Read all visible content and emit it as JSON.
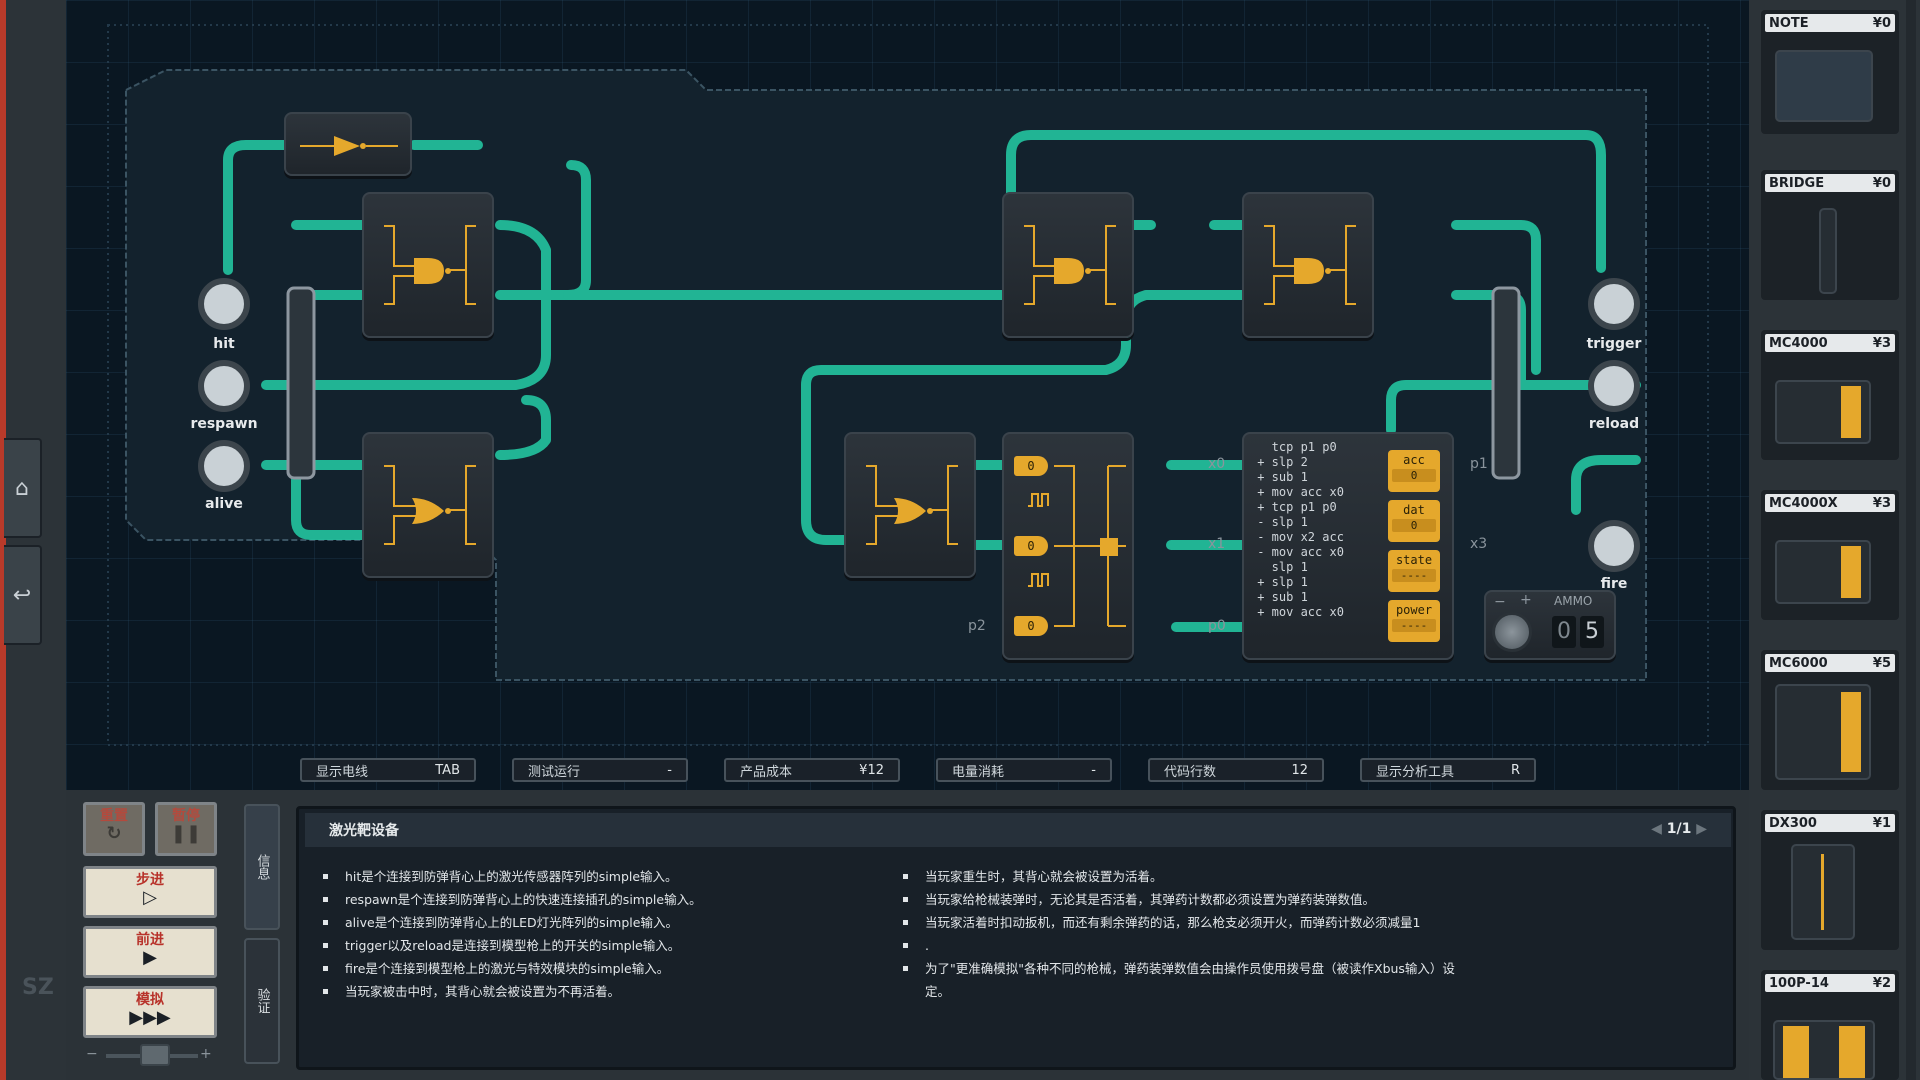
{
  "board": {
    "pins": {
      "hit": "hit",
      "respawn": "respawn",
      "alive": "alive",
      "trigger": "trigger",
      "reload": "reload",
      "fire": "fire"
    },
    "pin_labels": {
      "x0": "x0",
      "x1": "x1",
      "p2": "p2",
      "p0": "p0",
      "p1": "p1",
      "x3": "x3"
    },
    "mc_code": "   tcp p1 p0\n + slp 2\n + sub 1\n + mov acc x0\n + tcp p1 p0\n - slp 1\n - mov x2 acc\n - mov acc x0\n   slp 1\n + slp 1\n + sub 1\n + mov acc x0",
    "registers": [
      {
        "name": "acc",
        "value": "0"
      },
      {
        "name": "dat",
        "value": "0"
      },
      {
        "name": "state",
        "value": "----"
      },
      {
        "name": "power",
        "value": "----"
      }
    ],
    "dx_values": [
      "0",
      "0",
      "0"
    ],
    "ammo": {
      "title": "AMMO",
      "minus": "−",
      "plus": "+",
      "digits": [
        "0",
        "5"
      ]
    }
  },
  "statusbar": [
    {
      "label": "显示电线",
      "value": "TAB"
    },
    {
      "label": "测试运行",
      "value": "-"
    },
    {
      "label": "产品成本",
      "value": "¥12"
    },
    {
      "label": "电量消耗",
      "value": "-"
    },
    {
      "label": "代码行数",
      "value": "12"
    },
    {
      "label": "显示分析工具",
      "value": "R"
    }
  ],
  "controls": {
    "reset": "重置",
    "reset_icon": "↻",
    "pause": "暂停",
    "pause_icon": "❚❚",
    "step": "步进",
    "step_icon": "▷",
    "advance": "前进",
    "advance_icon": "▶",
    "simulate": "模拟",
    "simulate_icon": "▶▶▶",
    "slider_minus": "−",
    "slider_plus": "+"
  },
  "tabs": {
    "info": "信息",
    "verify": "验证"
  },
  "info": {
    "title": "激光靶设备",
    "page": "1/1",
    "left": [
      "hit是个连接到防弹背心上的激光传感器阵列的simple输入。",
      "respawn是个连接到防弹背心上的快速连接插孔的simple输入。",
      "alive是个连接到防弹背心上的LED灯光阵列的simple输入。",
      "trigger以及reload是连接到模型枪上的开关的simple输入。",
      "fire是个连接到模型枪上的激光与特效模块的simple输入。",
      "当玩家被击中时，其背心就会被设置为不再活着。"
    ],
    "right": [
      "当玩家重生时，其背心就会被设置为活着。",
      "当玩家给枪械装弹时，无论其是否活着，其弹药计数都必须设置为弹药装弹数值。",
      "当玩家活着时扣动扳机，而还有剩余弹药的话，那么枪支必须开火，而弹药计数必须减量1",
      ".",
      "为了\"更准确模拟\"各种不同的枪械，弹药装弹数值会由操作员使用拨号盘（被读作Xbus输入）设定。"
    ]
  },
  "parts": [
    {
      "name": "NOTE",
      "price": "¥0"
    },
    {
      "name": "BRIDGE",
      "price": "¥0"
    },
    {
      "name": "MC4000",
      "price": "¥3"
    },
    {
      "name": "MC4000X",
      "price": "¥3"
    },
    {
      "name": "MC6000",
      "price": "¥5"
    },
    {
      "name": "DX300",
      "price": "¥1"
    },
    {
      "name": "100P-14",
      "price": "¥2"
    }
  ],
  "sidebar": {
    "home_icon": "⌂",
    "back_icon": "↩",
    "brand": "SZ"
  },
  "colors": {
    "wire": "#23c4a0",
    "chip": "#e5a82c",
    "accent": "#b83a2a",
    "board": "#0a1722"
  }
}
